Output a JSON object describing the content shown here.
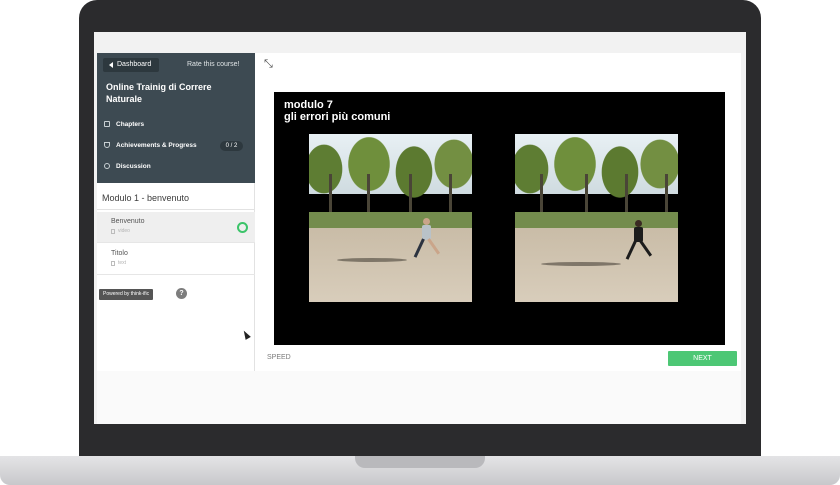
{
  "sidebar": {
    "dashboard_label": "Dashboard",
    "rate_label": "Rate this course!",
    "course_title": "Online Trainig di Correre Naturale",
    "menu": [
      {
        "label": "Chapters",
        "icon": "book-icon"
      },
      {
        "label": "Achievements & Progress",
        "icon": "trophy-icon"
      },
      {
        "label": "Discussion",
        "icon": "chat-icon"
      }
    ],
    "progress_badge": "0 / 2",
    "module_title": "Modulo 1 - benvenuto",
    "lessons": [
      {
        "name": "Benvenuto",
        "type": "video",
        "completed": true
      },
      {
        "name": "Titolo",
        "type": "text",
        "completed": false
      }
    ],
    "powered_by": "Powered by think-ific",
    "help_label": "?"
  },
  "main": {
    "video_title_line1": "modulo 7",
    "video_title_line2": "gli errori più comuni",
    "speed_label": "SPEED",
    "next_label": "NEXT"
  },
  "colors": {
    "sidebar_header": "#3d4a52",
    "accent_green": "#4dc775",
    "laptop_frame": "#2b2b2d"
  }
}
